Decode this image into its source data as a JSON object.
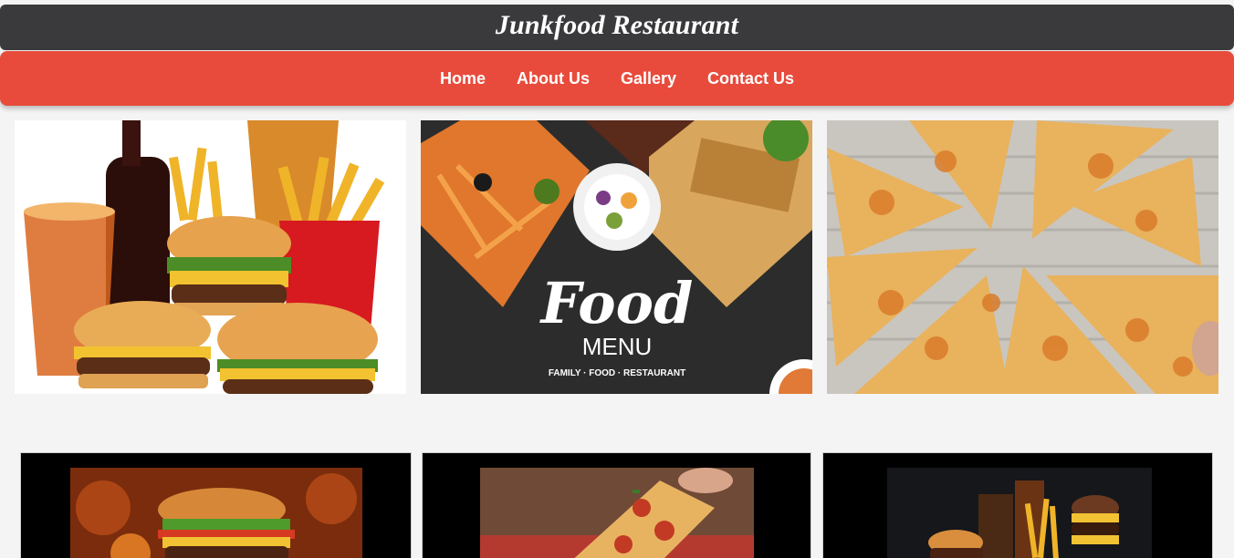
{
  "header": {
    "title": "Junkfood Restaurant"
  },
  "nav": {
    "items": [
      {
        "label": "Home"
      },
      {
        "label": "About Us"
      },
      {
        "label": "Gallery"
      },
      {
        "label": "Contact Us"
      }
    ]
  },
  "gallery": {
    "row1": [
      {
        "subject": "burgers-fries-soda-image"
      },
      {
        "subject": "food-menu-banner-image",
        "banner_title": "Food",
        "banner_subtitle": "MENU",
        "banner_tagline": "FAMILY · FOOD · RESTAURANT"
      },
      {
        "subject": "pepperoni-cheese-pizza-image"
      }
    ],
    "row2": [
      {
        "subject": "flame-burger-image"
      },
      {
        "subject": "pizza-slice-image"
      },
      {
        "subject": "burger-drinks-image"
      }
    ]
  },
  "colors": {
    "title_bar": "#3a393b",
    "nav_bar": "#e84b3c",
    "page_bg": "#f4f4f4"
  }
}
